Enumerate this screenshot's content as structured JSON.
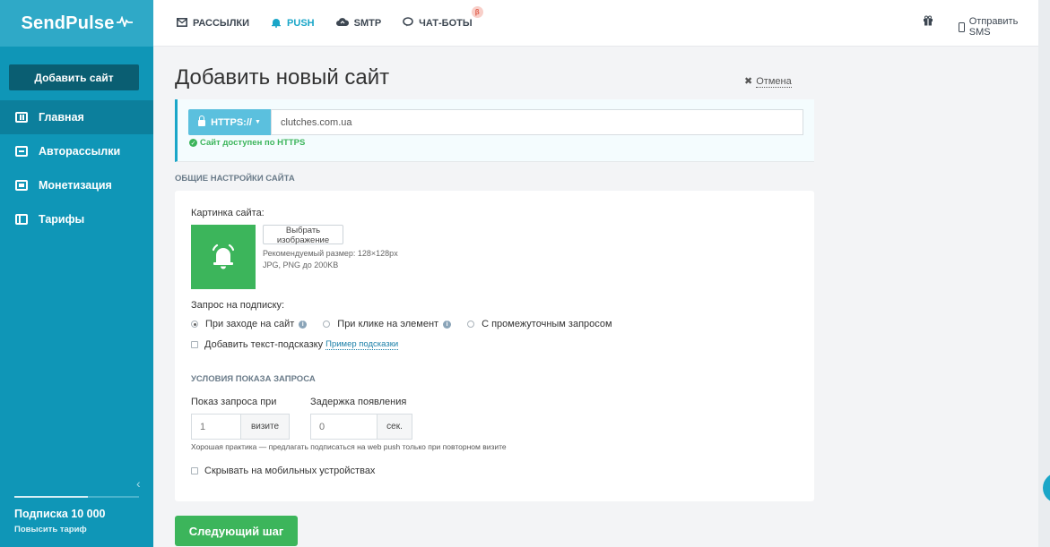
{
  "sidebar": {
    "logo": "SendPulse",
    "add_site_label": "Добавить сайт",
    "items": [
      {
        "label": "Главная",
        "icon": "dashboard-icon"
      },
      {
        "label": "Авторассылки",
        "icon": "autoresponder-icon"
      },
      {
        "label": "Монетизация",
        "icon": "monetization-icon"
      },
      {
        "label": "Тарифы",
        "icon": "pricing-icon"
      }
    ],
    "collapse_glyph": "‹",
    "plan": {
      "title": "Подписка 10 000",
      "upgrade": "Повысить тариф",
      "usage_fraction": 0.59
    }
  },
  "topbar": {
    "tabs": [
      {
        "label": "РАССЫЛКИ",
        "icon": "envelope-icon",
        "glyph": "✉"
      },
      {
        "label": "PUSH",
        "icon": "bell-icon",
        "glyph": "🔔"
      },
      {
        "label": "SMTP",
        "icon": "cloud-upload-icon",
        "glyph": "☁"
      },
      {
        "label": "ЧАТ-БОТЫ",
        "icon": "chat-icon",
        "glyph": "💬",
        "badge": "β"
      }
    ],
    "active_tab": "PUSH",
    "gift_glyph": "🎁",
    "send_sms": "Отправить SMS"
  },
  "page": {
    "title": "Добавить новый сайт",
    "cancel": "Отмена",
    "cancel_glyph": "✖"
  },
  "url": {
    "protocol": "HTTPS://",
    "value": "clutches.com.ua",
    "status": "Сайт доступен по HTTPS",
    "status_color": "#3cb55b"
  },
  "general": {
    "section_title": "ОБЩИЕ НАСТРОЙКИ САЙТА",
    "image_label": "Картинка сайта:",
    "choose_image": "Выбрать изображение",
    "recommended_size": "Рекомендуемый размер: 128×128px",
    "formats": "JPG, PNG до 200KB",
    "request_label": "Запрос на подписку:",
    "request_options": [
      {
        "label": "При заходе на сайт",
        "checked": true,
        "info": true
      },
      {
        "label": "При клике на элемент",
        "checked": false,
        "info": true
      },
      {
        "label": "С промежуточным запросом",
        "checked": false,
        "info": false
      }
    ],
    "hint_checkbox": "Добавить текст-подсказку",
    "hint_example": "Пример подсказки",
    "info_glyph": "i"
  },
  "conditions": {
    "section_title": "УСЛОВИЯ ПОКАЗА ЗАПРОСА",
    "show_label": "Показ запроса при",
    "show_value": "1",
    "show_unit": "визите",
    "delay_label": "Задержка появления",
    "delay_placeholder": "0",
    "delay_unit": "сек.",
    "practice": "Хорошая практика — предлагать подписаться на web push только при повторном визите",
    "hide_mobile": "Скрывать на мобильных устройствах"
  },
  "actions": {
    "next": "Следующий шаг"
  },
  "colors": {
    "sidebar": "#0f96b7",
    "accent": "#1aa6c8",
    "success": "#3cb55b"
  }
}
